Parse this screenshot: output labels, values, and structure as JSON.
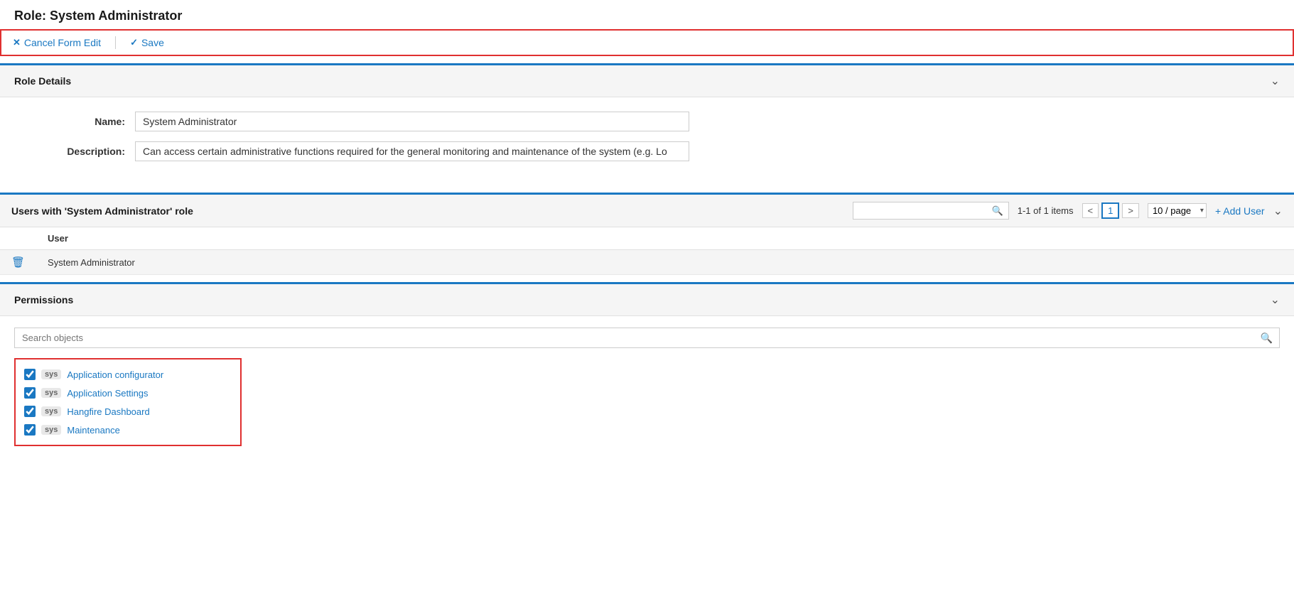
{
  "page": {
    "title": "Role: System Administrator"
  },
  "toolbar": {
    "cancel_label": "Cancel Form Edit",
    "save_label": "Save"
  },
  "role_details": {
    "section_title": "Role Details",
    "name_label": "Name:",
    "name_value": "System Administrator",
    "description_label": "Description:",
    "description_value": "Can access certain administrative functions required for the general monitoring and maintenance of the system (e.g. Lo"
  },
  "users_section": {
    "title": "Users with 'System Administrator' role",
    "search_placeholder": "",
    "pagination_info": "1-1 of 1 items",
    "current_page": "1",
    "page_size": "10 / page",
    "add_user_label": "+ Add User",
    "col_user": "User",
    "rows": [
      {
        "name": "System Administrator"
      }
    ]
  },
  "permissions_section": {
    "section_title": "Permissions",
    "search_placeholder": "Search objects",
    "items": [
      {
        "tag": "sys",
        "label": "Application configurator",
        "checked": true
      },
      {
        "tag": "sys",
        "label": "Application Settings",
        "checked": true
      },
      {
        "tag": "sys",
        "label": "Hangfire Dashboard",
        "checked": true
      },
      {
        "tag": "sys",
        "label": "Maintenance",
        "checked": true
      }
    ]
  }
}
